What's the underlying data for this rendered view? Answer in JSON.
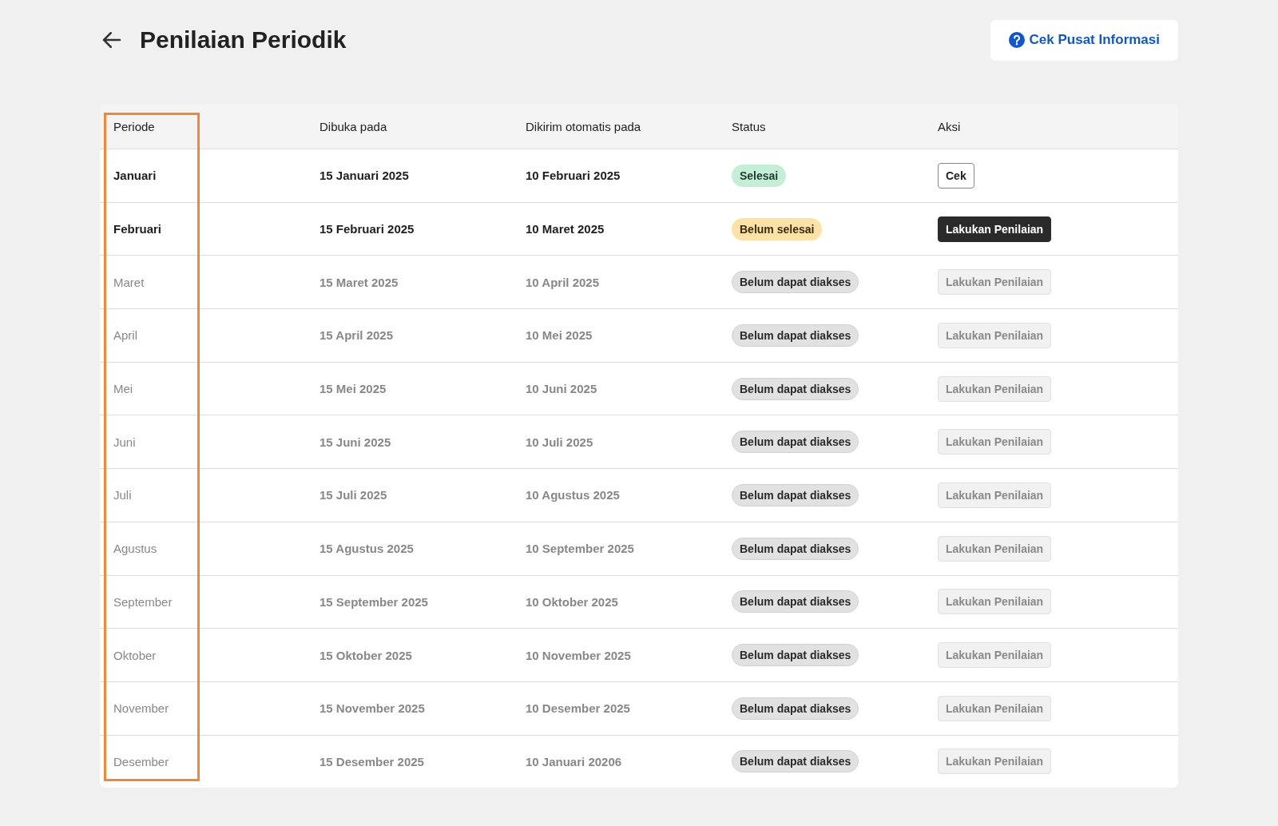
{
  "header": {
    "title": "Penilaian Periodik",
    "help_button": "Cek Pusat Informasi"
  },
  "table": {
    "columns": [
      "Periode",
      "Dibuka pada",
      "Dikirim otomatis pada",
      "Status",
      "Aksi"
    ],
    "rows": [
      {
        "period": "Januari",
        "opened": "15 Januari 2025",
        "sent": "10 Februari 2025",
        "status": {
          "kind": "done",
          "label": "Selesai"
        },
        "action": {
          "kind": "check",
          "label": "Cek"
        },
        "disabled": false
      },
      {
        "period": "Februari",
        "opened": "15 Februari 2025",
        "sent": "10 Maret 2025",
        "status": {
          "kind": "pending",
          "label": "Belum selesai"
        },
        "action": {
          "kind": "primary",
          "label": "Lakukan Penilaian"
        },
        "disabled": false
      },
      {
        "period": "Maret",
        "opened": "15 Maret 2025",
        "sent": "10 April 2025",
        "status": {
          "kind": "locked",
          "label": "Belum dapat diakses"
        },
        "action": {
          "kind": "primary",
          "label": "Lakukan Penilaian"
        },
        "disabled": true
      },
      {
        "period": "April",
        "opened": "15 April 2025",
        "sent": "10 Mei 2025",
        "status": {
          "kind": "locked",
          "label": "Belum dapat diakses"
        },
        "action": {
          "kind": "primary",
          "label": "Lakukan Penilaian"
        },
        "disabled": true
      },
      {
        "period": "Mei",
        "opened": "15 Mei 2025",
        "sent": "10 Juni 2025",
        "status": {
          "kind": "locked",
          "label": "Belum dapat diakses"
        },
        "action": {
          "kind": "primary",
          "label": "Lakukan Penilaian"
        },
        "disabled": true
      },
      {
        "period": "Juni",
        "opened": "15 Juni 2025",
        "sent": "10 Juli 2025",
        "status": {
          "kind": "locked",
          "label": "Belum dapat diakses"
        },
        "action": {
          "kind": "primary",
          "label": "Lakukan Penilaian"
        },
        "disabled": true
      },
      {
        "period": "Juli",
        "opened": "15 Juli 2025",
        "sent": "10 Agustus 2025",
        "status": {
          "kind": "locked",
          "label": "Belum dapat diakses"
        },
        "action": {
          "kind": "primary",
          "label": "Lakukan Penilaian"
        },
        "disabled": true
      },
      {
        "period": "Agustus",
        "opened": "15 Agustus 2025",
        "sent": "10 September 2025",
        "status": {
          "kind": "locked",
          "label": "Belum dapat diakses"
        },
        "action": {
          "kind": "primary",
          "label": "Lakukan Penilaian"
        },
        "disabled": true
      },
      {
        "period": "September",
        "opened": "15 September 2025",
        "sent": "10 Oktober 2025",
        "status": {
          "kind": "locked",
          "label": "Belum dapat diakses"
        },
        "action": {
          "kind": "primary",
          "label": "Lakukan Penilaian"
        },
        "disabled": true
      },
      {
        "period": "Oktober",
        "opened": "15 Oktober 2025",
        "sent": "10 November 2025",
        "status": {
          "kind": "locked",
          "label": "Belum dapat diakses"
        },
        "action": {
          "kind": "primary",
          "label": "Lakukan Penilaian"
        },
        "disabled": true
      },
      {
        "period": "November",
        "opened": "15 November 2025",
        "sent": "10 Desember 2025",
        "status": {
          "kind": "locked",
          "label": "Belum dapat diakses"
        },
        "action": {
          "kind": "primary",
          "label": "Lakukan Penilaian"
        },
        "disabled": true
      },
      {
        "period": "Desember",
        "opened": "15 Desember 2025",
        "sent": "10 Januari 20206",
        "status": {
          "kind": "locked",
          "label": "Belum dapat diakses"
        },
        "action": {
          "kind": "primary",
          "label": "Lakukan Penilaian"
        },
        "disabled": true
      }
    ]
  }
}
